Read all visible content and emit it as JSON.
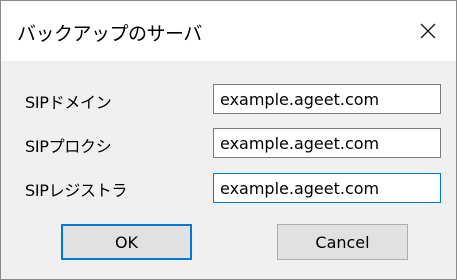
{
  "dialog": {
    "title": "バックアップのサーバ",
    "close_label": "×"
  },
  "fields": [
    {
      "label": "SIPドメイン",
      "value": "example.ageet.com",
      "focused": false
    },
    {
      "label": "SIPプロクシ",
      "value": "example.ageet.com",
      "focused": false
    },
    {
      "label": "SIPレジストラ",
      "value": "example.ageet.com",
      "focused": true
    }
  ],
  "buttons": {
    "ok_label": "OK",
    "cancel_label": "Cancel"
  }
}
